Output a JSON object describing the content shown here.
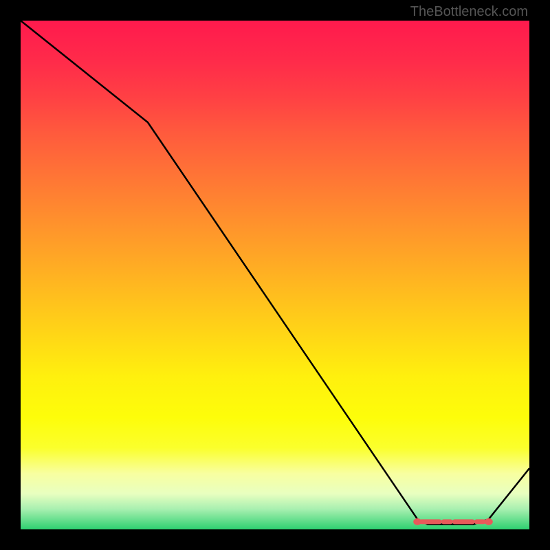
{
  "watermark": "TheBottleneck.com",
  "chart_data": {
    "type": "line",
    "title": "",
    "xlabel": "",
    "ylabel": "",
    "xlim": [
      0,
      100
    ],
    "ylim": [
      0,
      100
    ],
    "x": [
      0,
      25,
      78,
      80,
      83,
      86,
      89,
      92,
      100
    ],
    "values": [
      100,
      80,
      2,
      1,
      1,
      1,
      1,
      2,
      12
    ],
    "marker_segment": {
      "x_start": 78,
      "x_end": 92,
      "y": 1.5,
      "color": "#e85a5a"
    },
    "line_color": "#000000",
    "background_gradient": [
      "#ff1a4d",
      "#ffd716",
      "#2ed070"
    ]
  }
}
